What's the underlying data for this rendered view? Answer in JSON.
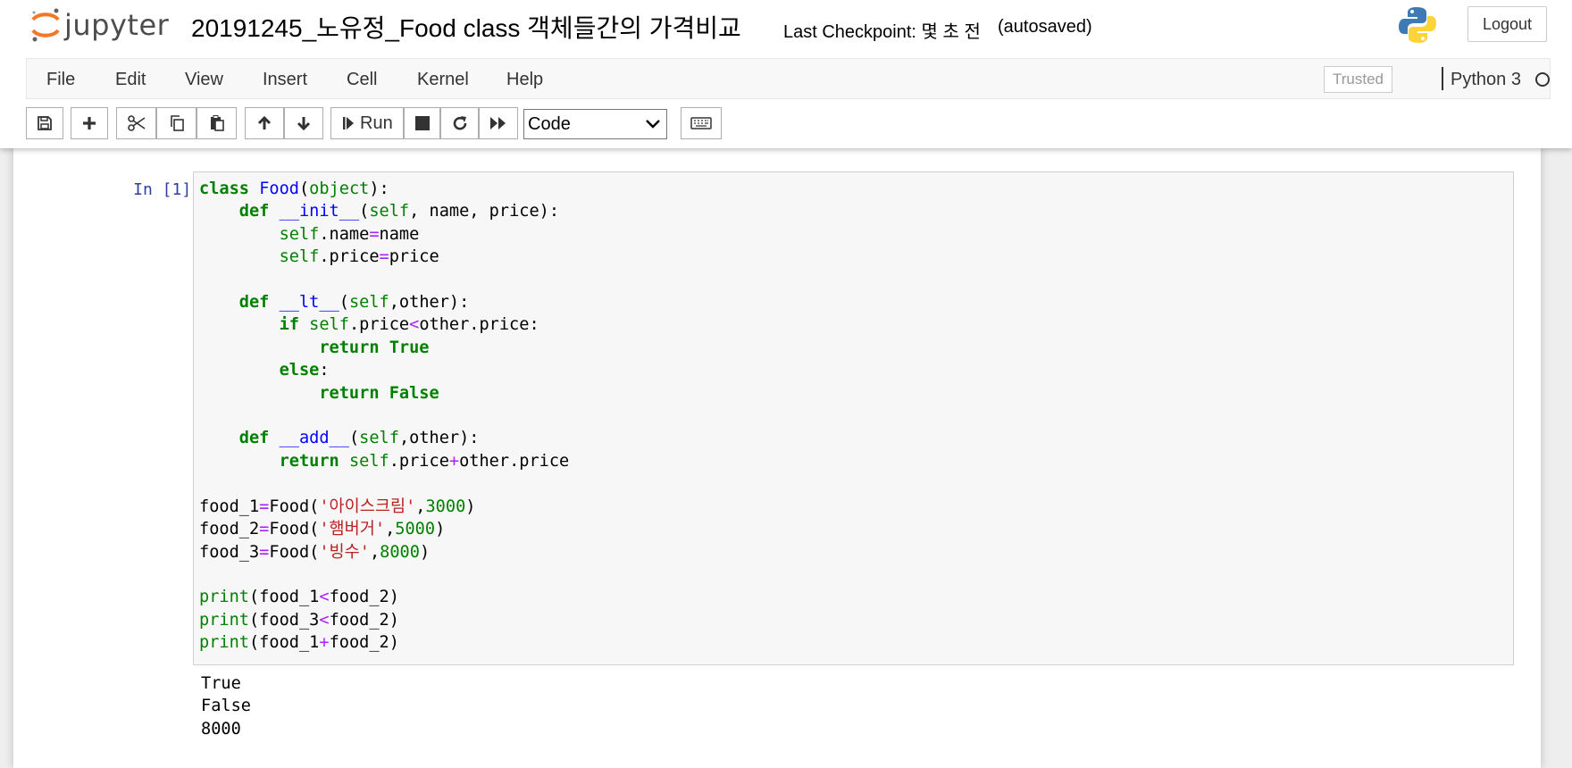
{
  "header": {
    "logo_text": "jupyter",
    "notebook_title": "20191245_노유정_Food class 객체들간의 가격비교",
    "checkpoint": "Last Checkpoint: 몇 초 전",
    "autosaved": "(autosaved)",
    "logout_label": "Logout"
  },
  "menubar": {
    "items": [
      "File",
      "Edit",
      "View",
      "Insert",
      "Cell",
      "Kernel",
      "Help"
    ],
    "trusted": "Trusted",
    "kernel_name": "Python 3"
  },
  "toolbar": {
    "buttons": [
      "save-icon",
      "add-cell-icon",
      "cut-icon",
      "copy-icon",
      "paste-icon",
      "move-up-icon",
      "move-down-icon",
      "run",
      "stop-icon",
      "restart-icon",
      "fast-forward-icon",
      "keyboard-icon"
    ],
    "run_label": "Run",
    "cell_type": "Code"
  },
  "cell": {
    "prompt": "In [1]:",
    "code_lines": [
      "class Food(object):",
      "    def __init__(self, name, price):",
      "        self.name=name",
      "        self.price=price",
      "",
      "    def __lt__(self,other):",
      "        if self.price<other.price:",
      "            return True",
      "        else:",
      "            return False",
      "",
      "    def __add__(self,other):",
      "        return self.price+other.price",
      "",
      "food_1=Food('아이스크림',3000)",
      "food_2=Food('햄버거',5000)",
      "food_3=Food('빙수',8000)",
      "",
      "print(food_1<food_2)",
      "print(food_3<food_2)",
      "print(food_1+food_2)"
    ],
    "output_lines": [
      "True",
      "False",
      "8000"
    ]
  }
}
